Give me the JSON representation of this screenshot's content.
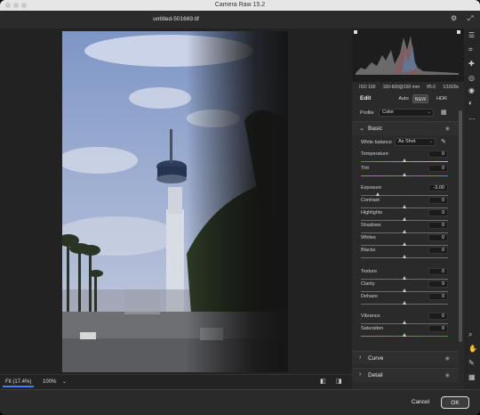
{
  "window": {
    "title": "Camera Raw 15.2"
  },
  "document": {
    "filename": "untitled-501669.tif"
  },
  "header_icons": [
    "gear-icon",
    "fullscreen-icon"
  ],
  "histogram": {
    "meta": {
      "iso": "ISO 100",
      "focal": "150-600@150 mm",
      "aperture": "f/5.6",
      "shutter": "1/1600s"
    }
  },
  "edit": {
    "title": "Edit",
    "modes": [
      {
        "label": "Auto",
        "active": false
      },
      {
        "label": "B&W",
        "active": true
      },
      {
        "label": "HDR",
        "active": false
      }
    ],
    "profile": {
      "label": "Profile",
      "value": "Color"
    }
  },
  "basic": {
    "title": "Basic",
    "white_balance": {
      "label": "White balance",
      "value": "As Shot"
    },
    "sliders": [
      {
        "name": "Temperature",
        "value": "0",
        "pos": 0.5,
        "track": "temp"
      },
      {
        "name": "Tint",
        "value": "0",
        "pos": 0.5,
        "track": "tint"
      },
      {
        "name": "Exposure",
        "value": "-3.00",
        "pos": 0.2,
        "track": "gray"
      },
      {
        "name": "Contrast",
        "value": "0",
        "pos": 0.5,
        "track": "gray"
      },
      {
        "name": "Highlights",
        "value": "0",
        "pos": 0.5,
        "track": "gray"
      },
      {
        "name": "Shadows",
        "value": "0",
        "pos": 0.5,
        "track": "gray"
      },
      {
        "name": "Whites",
        "value": "0",
        "pos": 0.5,
        "track": "gray"
      },
      {
        "name": "Blacks",
        "value": "0",
        "pos": 0.5,
        "track": "gray"
      },
      {
        "name": "Texture",
        "value": "0",
        "pos": 0.5,
        "track": "gray"
      },
      {
        "name": "Clarity",
        "value": "0",
        "pos": 0.5,
        "track": "gray"
      },
      {
        "name": "Dehaze",
        "value": "0",
        "pos": 0.5,
        "track": "gray"
      },
      {
        "name": "Vibrance",
        "value": "0",
        "pos": 0.5,
        "track": "gray"
      },
      {
        "name": "Saturation",
        "value": "0",
        "pos": 0.5,
        "track": "sat"
      }
    ]
  },
  "collapsed_sections": [
    "Curve",
    "Detail"
  ],
  "zoom": {
    "fit": "Fit (17.4%)",
    "level": "100%"
  },
  "footer_buttons": {
    "cancel": "Cancel",
    "ok": "OK"
  },
  "colors": {
    "accent": "#3b82f6",
    "panel": "#2a2a2a",
    "canvas": "#222222"
  }
}
